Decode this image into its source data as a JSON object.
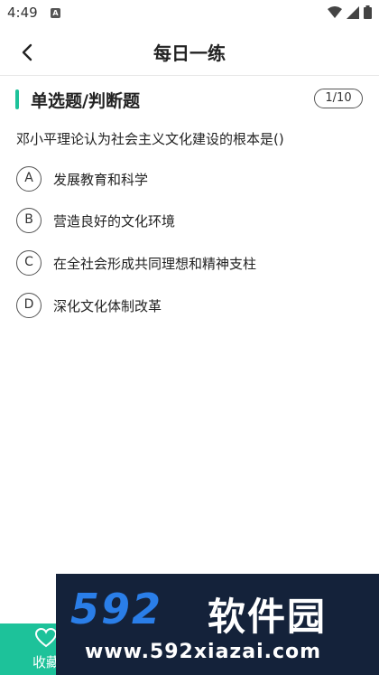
{
  "status": {
    "time": "4:49",
    "app_icon_letter": "A"
  },
  "header": {
    "title": "每日一练"
  },
  "question": {
    "type_label": "单选题/判断题",
    "progress": "1/10",
    "text": "邓小平理论认为社会主义文化建设的根本是()",
    "options": [
      {
        "letter": "A",
        "text": "发展教育和科学"
      },
      {
        "letter": "B",
        "text": "营造良好的文化环境"
      },
      {
        "letter": "C",
        "text": "在全社会形成共同理想和精神支柱"
      },
      {
        "letter": "D",
        "text": "深化文化体制改革"
      }
    ]
  },
  "bottom": {
    "favorite_label": "收藏"
  },
  "watermark": {
    "logo_number": "592",
    "brand": "软件园",
    "url": "www.592xiazai.com"
  },
  "colors": {
    "accent": "#1dc29a",
    "watermark_bg": "#14223a"
  }
}
